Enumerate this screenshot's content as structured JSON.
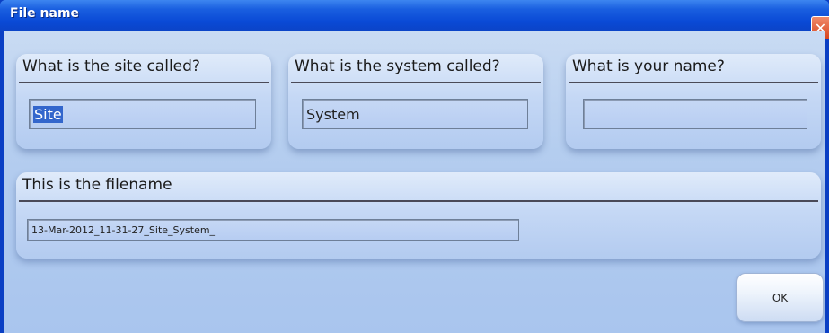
{
  "window": {
    "title": "File name",
    "close_glyph": "✕"
  },
  "fields": {
    "site": {
      "label": "What is the site called?",
      "value": "Site"
    },
    "system": {
      "label": "What is the system called?",
      "value": "System"
    },
    "name": {
      "label": "What is your name?",
      "value": ""
    }
  },
  "filename": {
    "label": "This is the filename",
    "value": "13-Mar-2012_11-31-27_Site_System_"
  },
  "buttons": {
    "ok_label": "OK"
  },
  "colors": {
    "titlebar": "#0a4ad6",
    "client": "#b4cdef",
    "selection": "#3366cc"
  }
}
